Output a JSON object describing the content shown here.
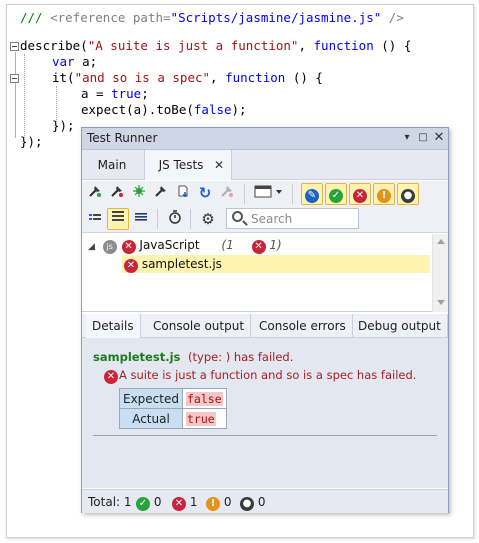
{
  "code": {
    "line1_comment": "/// ",
    "line1_tag_open": "<reference ",
    "line1_attr": "path=",
    "line1_value": "\"Scripts/jasmine/jasmine.js\"",
    "line1_tag_close": " />",
    "describe": "describe(",
    "describe_str": "\"A suite is just a function\"",
    "describe_sep": ", ",
    "function_kw": "function",
    "describe_tail": " () {",
    "var_kw": "var",
    "var_rest": " a;",
    "it": "it(",
    "it_str": "\"and so is a spec\"",
    "it_sep": ", ",
    "it_tail": " () {",
    "assign": "a = ",
    "true_kw": "true",
    "semicolon": ";",
    "expect_a": "expect(a).toBe(",
    "false_kw": "false",
    "expect_b": ");",
    "close_it": "});",
    "close_describe": "});"
  },
  "runner": {
    "title": "Test Runner",
    "tabs": [
      {
        "label": "Main"
      },
      {
        "label": "JS Tests"
      }
    ],
    "search_placeholder": "Search",
    "tree": {
      "group_badge": "js",
      "group_label": "JavaScript",
      "group_total": "(1",
      "group_failed": "1)",
      "file_label": "sampletest.js"
    },
    "detail_tabs": [
      "Details",
      "Console output",
      "Console errors",
      "Debug output"
    ],
    "details": {
      "file": "sampletest.js",
      "type_text": "(type: ) has failed.",
      "message": "A suite is just a function and so is a spec has failed.",
      "expected_label": "Expected",
      "expected_value": "false",
      "actual_label": "Actual",
      "actual_value": "true"
    },
    "status": {
      "total_label": "Total: 1",
      "passed": "0",
      "failed": "1",
      "warnings": "0",
      "skipped": "0"
    }
  },
  "colors": {
    "keyword": "#0000ff",
    "string": "#a31515",
    "comment": "#008000",
    "fail_red": "#c8243a",
    "pass_green": "#29a33b",
    "warn_orange": "#e19419",
    "selection_yellow": "#fff3b2"
  }
}
